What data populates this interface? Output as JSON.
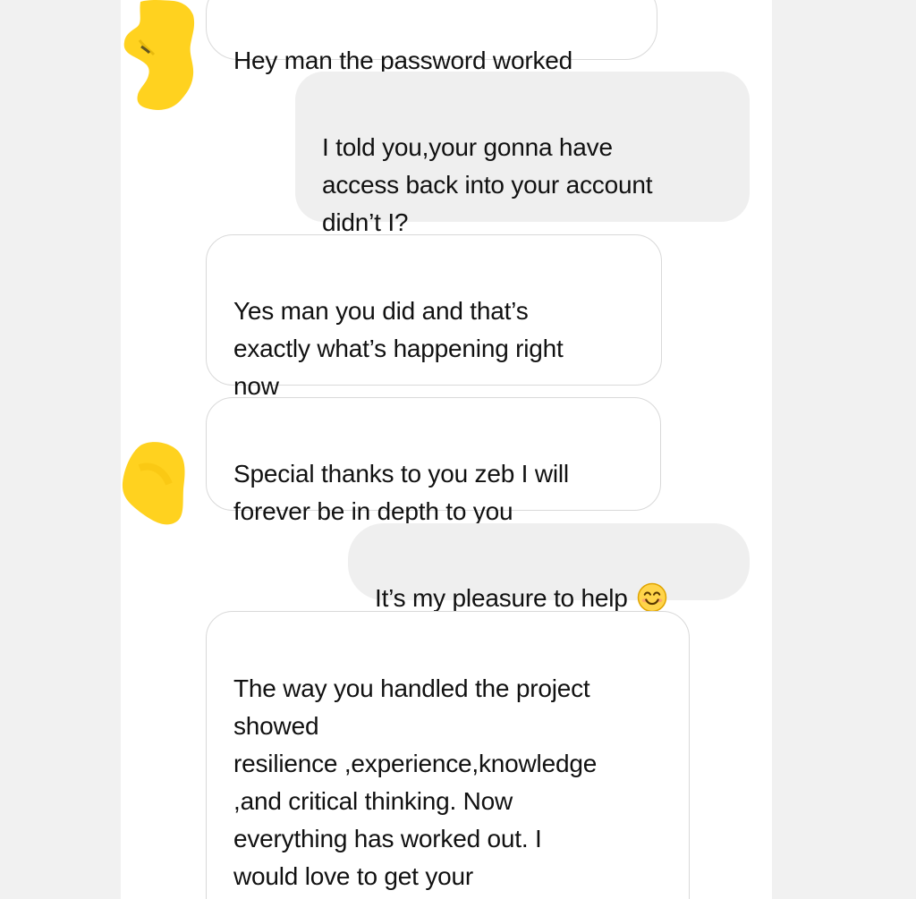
{
  "conversation": {
    "messages": [
      {
        "direction": "incoming",
        "text": "Hey man the password worked"
      },
      {
        "direction": "outgoing",
        "text": "I told you,your gonna have\naccess back into your account\ndidn’t I?"
      },
      {
        "direction": "incoming",
        "text": "Yes man you did and that’s\nexactly what’s happening right\nnow"
      },
      {
        "direction": "incoming",
        "text": "Special thanks to you zeb I will\nforever be in depth to you"
      },
      {
        "direction": "outgoing",
        "text": "It’s my pleasure to help",
        "emoji": "smiling-face-with-smiling-eyes-icon"
      },
      {
        "direction": "incoming",
        "text": "The way you handled the project\nshowed\nresilience ,experience,knowledge\n,and critical thinking. Now\neverything has worked out. I\nwould love to get your\nperspective on the higher"
      }
    ]
  },
  "style": {
    "canvas_background": "#ffffff",
    "outer_background": "#f1f1f1",
    "outgoing_bubble": "#efefef",
    "incoming_border": "#d9d9d9",
    "text_color": "#111111",
    "avatar_redaction": "#ffd21f"
  }
}
